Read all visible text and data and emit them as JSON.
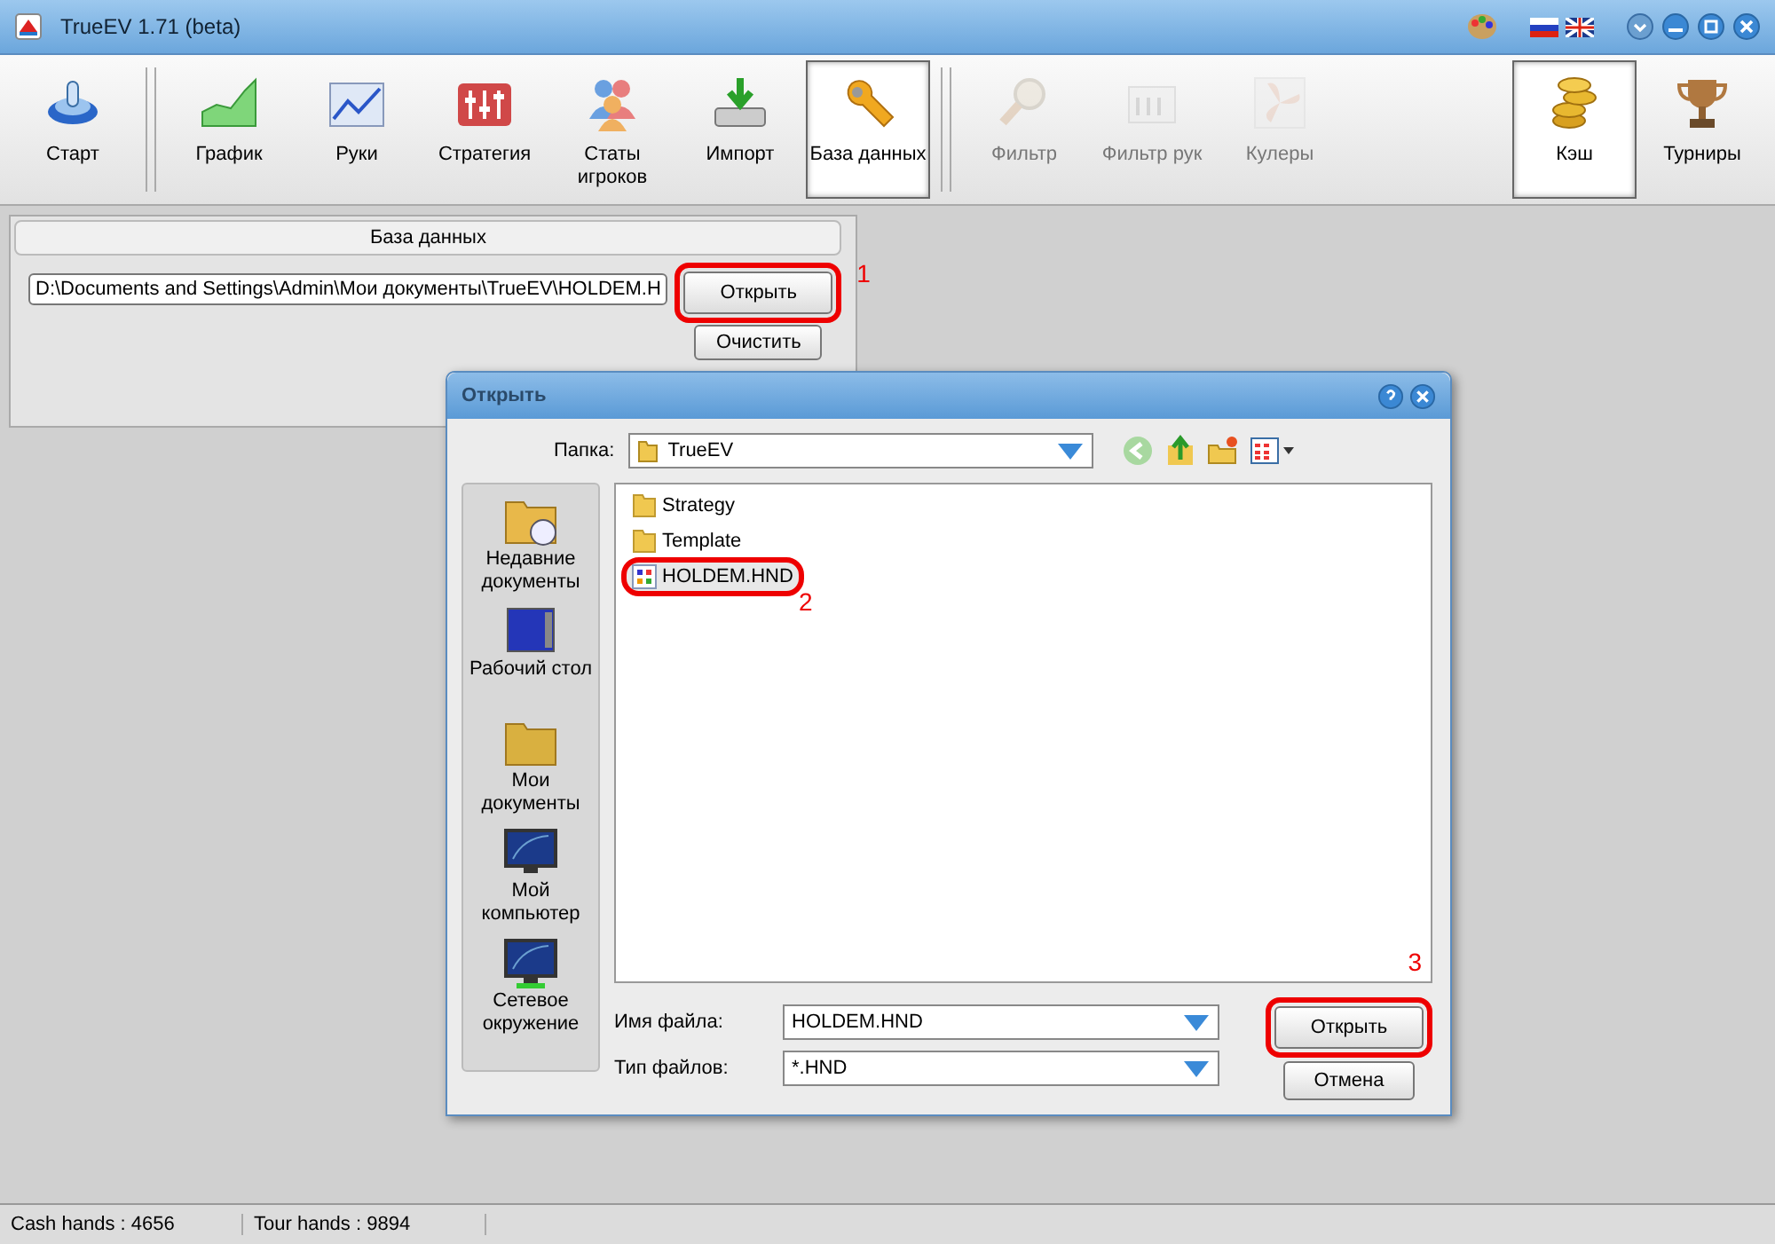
{
  "window": {
    "title": "TrueEV 1.71 (beta)"
  },
  "toolbar": {
    "groups": [
      {
        "items": [
          {
            "label": "Старт",
            "selected": false,
            "disabled": false
          }
        ]
      },
      {
        "items": [
          {
            "label": "График",
            "selected": false,
            "disabled": false
          },
          {
            "label": "Руки",
            "selected": false,
            "disabled": false
          },
          {
            "label": "Стратегия",
            "selected": false,
            "disabled": false
          },
          {
            "label": "Статы игроков",
            "selected": false,
            "disabled": false
          },
          {
            "label": "Импорт",
            "selected": false,
            "disabled": false
          },
          {
            "label": "База данных",
            "selected": true,
            "disabled": false
          }
        ]
      },
      {
        "items": [
          {
            "label": "Фильтр",
            "selected": false,
            "disabled": true
          },
          {
            "label": "Фильтр рук",
            "selected": false,
            "disabled": true
          },
          {
            "label": "Кулеры",
            "selected": false,
            "disabled": true
          }
        ]
      },
      {
        "items": [
          {
            "label": "Кэш",
            "selected": true,
            "disabled": false
          },
          {
            "label": "Турниры",
            "selected": false,
            "disabled": false
          }
        ]
      }
    ]
  },
  "database_panel": {
    "title": "База данных",
    "path": "D:\\Documents and Settings\\Admin\\Мои документы\\TrueEV\\HOLDEM.H",
    "open_button": "Открыть",
    "clear_button": "Очистить",
    "step": "1"
  },
  "dialog": {
    "title": "Открыть",
    "folder_label": "Папка:",
    "folder": "TrueEV",
    "places": [
      {
        "label": "Недавние документы"
      },
      {
        "label": "Рабочий стол"
      },
      {
        "label": "Мои документы"
      },
      {
        "label": "Мой компьютер"
      },
      {
        "label": "Сетевое окружение"
      }
    ],
    "files": [
      {
        "name": "Strategy",
        "kind": "folder",
        "selected": false
      },
      {
        "name": "Template",
        "kind": "folder",
        "selected": false
      },
      {
        "name": "HOLDEM.HND",
        "kind": "file",
        "selected": true
      }
    ],
    "file_step": "2",
    "filename_label": "Имя файла:",
    "filename": "HOLDEM.HND",
    "filetype_label": "Тип файлов:",
    "filetype": "*.HND",
    "open_button": "Открыть",
    "cancel_button": "Отмена",
    "open_step": "3"
  },
  "status_bar": [
    "Cash hands : 4656",
    "Tour hands : 9894"
  ]
}
